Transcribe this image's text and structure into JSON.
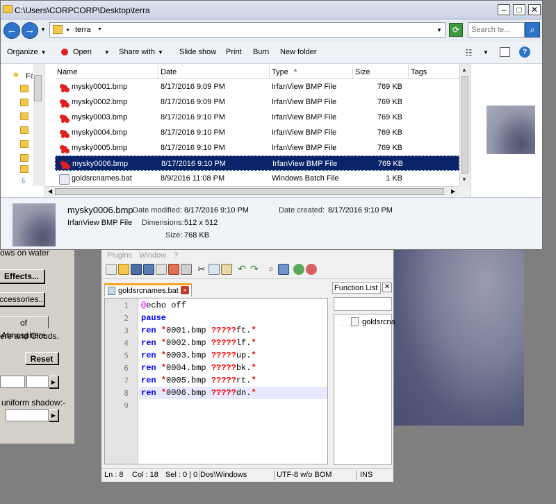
{
  "explorer": {
    "title": "C:\\Users\\CORPCORP\\Desktop\\terra",
    "address": "terra",
    "search_placeholder": "Search te...",
    "commands": {
      "organize": "Organize",
      "open": "Open",
      "share_with": "Share with",
      "slide_show": "Slide show",
      "print": "Print",
      "burn": "Burn",
      "new_folder": "New folder"
    },
    "nav_label": "Fa",
    "columns": {
      "name": "Name",
      "date": "Date",
      "type": "Type",
      "size": "Size",
      "tags": "Tags"
    },
    "files": [
      {
        "name": "mysky0001.bmp",
        "date": "8/17/2016 9:09 PM",
        "type": "IrfanView BMP File",
        "size": "769 KB"
      },
      {
        "name": "mysky0002.bmp",
        "date": "8/17/2016 9:09 PM",
        "type": "IrfanView BMP File",
        "size": "769 KB"
      },
      {
        "name": "mysky0003.bmp",
        "date": "8/17/2016 9:10 PM",
        "type": "IrfanView BMP File",
        "size": "769 KB"
      },
      {
        "name": "mysky0004.bmp",
        "date": "8/17/2016 9:10 PM",
        "type": "IrfanView BMP File",
        "size": "769 KB"
      },
      {
        "name": "mysky0005.bmp",
        "date": "8/17/2016 9:10 PM",
        "type": "IrfanView BMP File",
        "size": "769 KB"
      },
      {
        "name": "mysky0006.bmp",
        "date": "8/17/2016 9:10 PM",
        "type": "IrfanView BMP File",
        "size": "769 KB"
      },
      {
        "name": "goldsrcnames.bat",
        "date": "8/9/2016 11:08 PM",
        "type": "Windows Batch File",
        "size": "1 KB"
      }
    ],
    "details": {
      "filename": "mysky0006.bmp",
      "filetype": "IrfanView BMP File",
      "date_modified_label": "Date modified:",
      "date_modified": "8/17/2016 9:10 PM",
      "date_created_label": "Date created:",
      "date_created": "8/17/2016 9:10 PM",
      "dimensions_label": "Dimensions:",
      "dimensions": "512 x 512",
      "size_label": "Size:",
      "size": "768 KB"
    }
  },
  "notepad": {
    "menu": {
      "plugins": "Plugins",
      "window": "Window",
      "help": "?"
    },
    "tab_label": "goldsrcnames.bat",
    "function_list_title": "Function List",
    "function_list_item": "goldsrcna",
    "lines": [
      {
        "n": "1",
        "a": "@",
        "b": "echo off"
      },
      {
        "n": "2",
        "k": "pause"
      },
      {
        "n": "3",
        "k": "ren",
        "s1": " ",
        "w1": "*",
        "f1": "0001.bmp ",
        "w2": "?????",
        "f2": "ft.",
        "w3": "*"
      },
      {
        "n": "4",
        "k": "ren",
        "s1": " ",
        "w1": "*",
        "f1": "0002.bmp ",
        "w2": "?????",
        "f2": "lf.",
        "w3": "*"
      },
      {
        "n": "5",
        "k": "ren",
        "s1": " ",
        "w1": "*",
        "f1": "0003.bmp ",
        "w2": "?????",
        "f2": "up.",
        "w3": "*"
      },
      {
        "n": "6",
        "k": "ren",
        "s1": " ",
        "w1": "*",
        "f1": "0004.bmp ",
        "w2": "?????",
        "f2": "bk.",
        "w3": "*"
      },
      {
        "n": "7",
        "k": "ren",
        "s1": " ",
        "w1": "*",
        "f1": "0005.bmp ",
        "w2": "?????",
        "f2": "rt.",
        "w3": "*"
      },
      {
        "n": "8",
        "k": "ren",
        "s1": " ",
        "w1": "*",
        "f1": "0006.bmp ",
        "w2": "?????",
        "f2": "dn.",
        "w3": "*"
      },
      {
        "n": "9"
      }
    ],
    "status": {
      "ln": "Ln : 8",
      "col": "Col : 18",
      "sel": "Sel : 0 | 0",
      "eol": "Dos\\Windows",
      "encoding": "UTF-8 w/o BOM",
      "mode": "INS"
    }
  },
  "left_app": {
    "shadows_on_water": "ows on water",
    "effects": "Effects...",
    "accessories": "ccessories...",
    "atmosphere_tab": "of Atmosphere",
    "clouds_text": "ere and Clouds.",
    "reset": "Reset",
    "uniform_shadow": "uniform shadow:-"
  }
}
